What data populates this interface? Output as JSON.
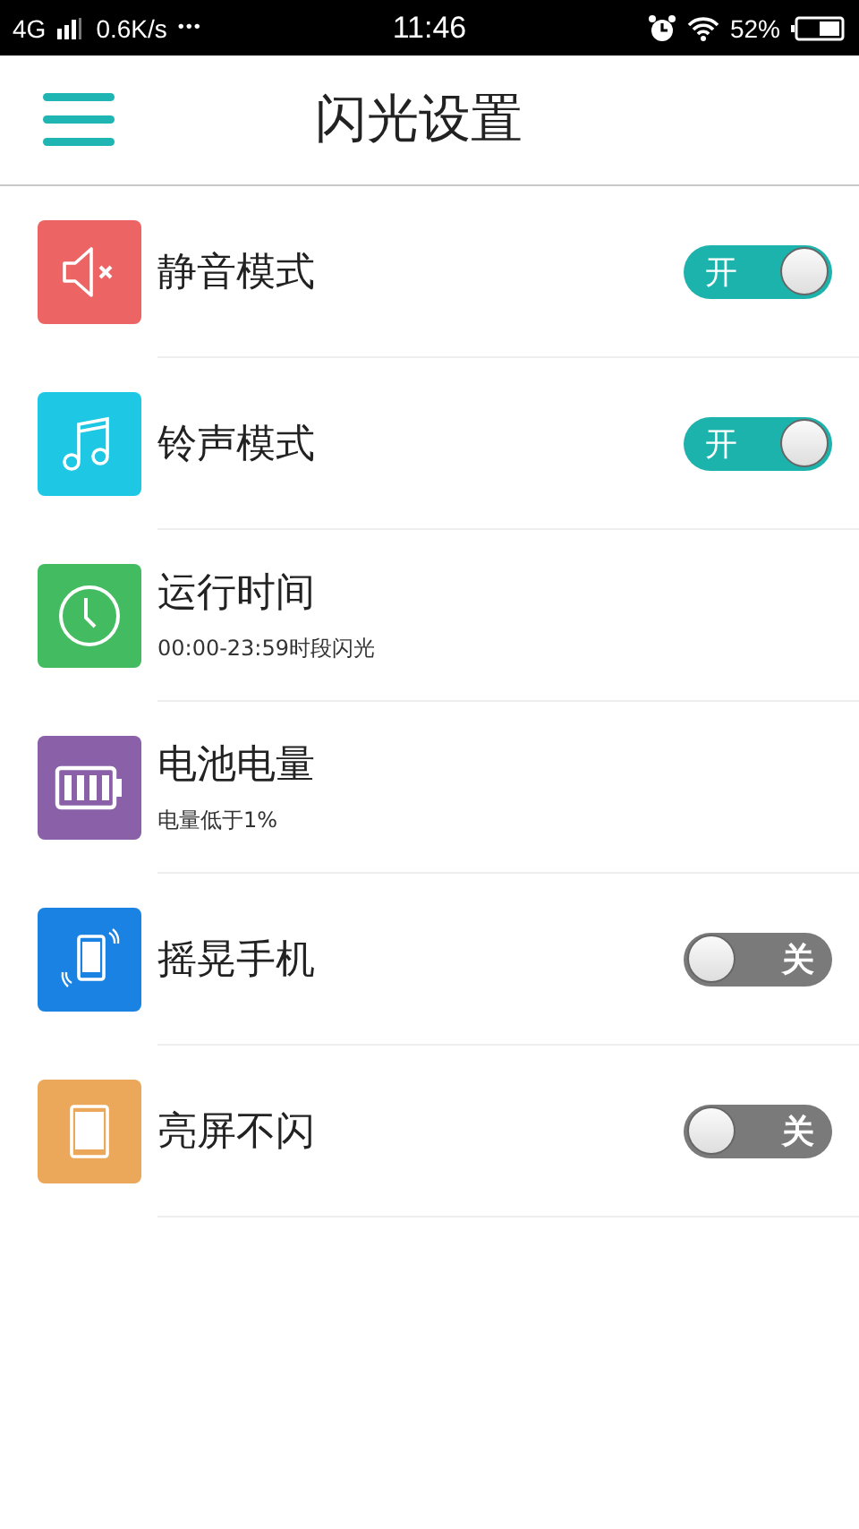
{
  "status_bar": {
    "network": "4G",
    "speed": "0.6K/s",
    "more": "•••",
    "time": "11:46",
    "battery": "52%"
  },
  "header": {
    "title": "闪光设置"
  },
  "items": [
    {
      "kind": "toggle",
      "title": "静音模式",
      "color": "#ec6464",
      "on": true,
      "switch_label": "开"
    },
    {
      "kind": "toggle",
      "title": "铃声模式",
      "color": "#1ec8e4",
      "on": true,
      "switch_label": "开"
    },
    {
      "kind": "info",
      "title": "运行时间",
      "color": "#43bb60",
      "subtitle": "00:00-23:59时段闪光"
    },
    {
      "kind": "info",
      "title": "电池电量",
      "color": "#8a60a8",
      "subtitle": "电量低于1%"
    },
    {
      "kind": "toggle",
      "title": "摇晃手机",
      "color": "#1a82e2",
      "on": false,
      "switch_label": "关"
    },
    {
      "kind": "toggle",
      "title": "亮屏不闪",
      "color": "#eba85a",
      "on": false,
      "switch_label": "关"
    }
  ]
}
